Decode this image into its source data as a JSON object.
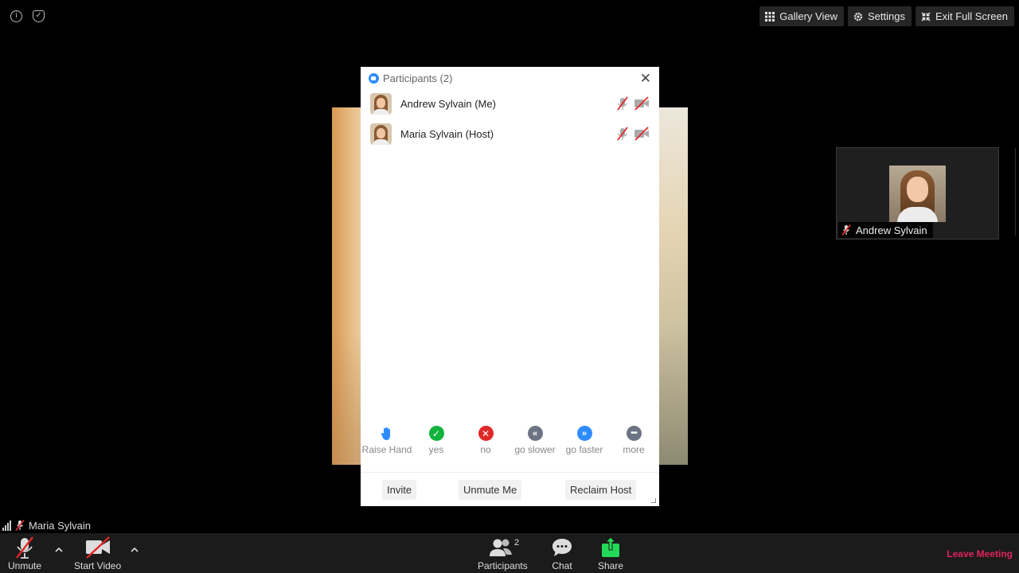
{
  "topbar": {
    "gallery_view": "Gallery View",
    "settings": "Settings",
    "exit_full_screen": "Exit Full Screen"
  },
  "thumbnail": {
    "name": "Andrew Sylvain"
  },
  "panel": {
    "title": "Participants (2)",
    "participants": [
      {
        "name": "Andrew Sylvain (Me)",
        "mic": "muted",
        "video": "off"
      },
      {
        "name": "Maria Sylvain (Host)",
        "mic": "muted",
        "video": "off"
      }
    ],
    "reactions": [
      {
        "label": "Raise Hand",
        "icon": "raise-hand-icon",
        "color": "#2d8cff"
      },
      {
        "label": "yes",
        "icon": "check-icon",
        "color": "#12b33d"
      },
      {
        "label": "no",
        "icon": "x-icon",
        "color": "#e02828"
      },
      {
        "label": "go slower",
        "icon": "rewind-icon",
        "color": "#6c7484"
      },
      {
        "label": "go faster",
        "icon": "fast-forward-icon",
        "color": "#2d8cff"
      },
      {
        "label": "more",
        "icon": "ellipsis-icon",
        "color": "#6c7484"
      }
    ],
    "footer": {
      "invite": "Invite",
      "unmute_me": "Unmute Me",
      "reclaim_host": "Reclaim Host"
    }
  },
  "self_label": {
    "name": "Maria Sylvain"
  },
  "toolbar": {
    "unmute": "Unmute",
    "start_video": "Start Video",
    "participants": "Participants",
    "participants_count": "2",
    "chat": "Chat",
    "share": "Share",
    "leave_meeting": "Leave Meeting"
  },
  "colors": {
    "accent": "#2d8cff",
    "share_green": "#23d959",
    "leave_red": "#e0245e",
    "muted_red": "#e02828"
  }
}
